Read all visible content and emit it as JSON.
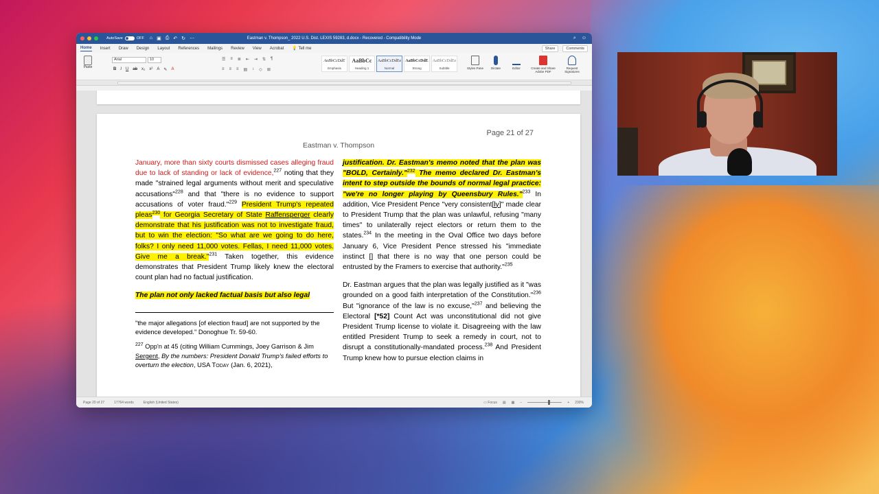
{
  "window": {
    "title": "Eastman v. Thompson_ 2022 U.S. Dist. LEXIS 59283, d.docx  -  Recovered  -  Compatibility Mode",
    "autosave_label": "AutoSave",
    "autosave_state": "OFF"
  },
  "ribbon_tabs": [
    "Home",
    "Insert",
    "Draw",
    "Design",
    "Layout",
    "References",
    "Mailings",
    "Review",
    "View",
    "Acrobat"
  ],
  "tell_me": "Tell me",
  "share_label": "Share",
  "comments_label": "Comments",
  "ribbon": {
    "paste_label": "Paste",
    "font_name": "Arial",
    "font_size": "10",
    "styles": [
      {
        "preview": "AaBbCcDdE",
        "name": "Emphasis"
      },
      {
        "preview": "AaBbCc",
        "name": "Heading 1"
      },
      {
        "preview": "AaBbCcDdEe",
        "name": "Normal"
      },
      {
        "preview": "AaBbCcDdE",
        "name": "Strong"
      },
      {
        "preview": "AaBbCcDdEe",
        "name": "Subtitle"
      }
    ],
    "styles_pane": "Styles\nPane",
    "dictate": "Dictate",
    "editor": "Editor",
    "create_pdf": "Create and Share\nAdobe PDF",
    "request_signatures": "Request\nSignatures"
  },
  "document": {
    "page_number": "Page 21 of 27",
    "running_head": "Eastman v. Thompson",
    "left_col": {
      "p1_red": "January, more than sixty courts dismissed cases alleging fraud due to lack of standing or lack of evidence,",
      "fn227": "227",
      "p1_a": " noting that they made \"strained legal arguments without merit and speculative accusations\"",
      "fn228": "228",
      "p1_b": " and that \"there is no evidence to support accusations of voter fraud.\"",
      "fn229": "229",
      "p1_hl1": "President Trump's repeated pleas",
      "fn230": "230",
      "p1_hl2": " for Georgia Secretary of State ",
      "raffensperger": "Raffensperger",
      "p1_hl3": " clearly demonstrate that his justification was not to investigate fraud, but to win the election: \"So what are we going to do here, folks? I only need 11,000 votes. Fellas, I need 11,000 votes. Give me a break.\"",
      "fn231": "231",
      "p1_c": " Taken together, this evidence demonstrates that President Trump likely knew the electoral count plan had no factual justification.",
      "p2_bi": "The plan not only lacked factual basis but also legal",
      "footnote_cont": "\"the major allegations [of election fraud] are not supported by the evidence developed.\" Donoghue Tr. 59-60.",
      "footnote227_num": "227",
      "footnote227_a": " Opp'n at 45 (citing William Cummings, Joey Garrison & Jim ",
      "sergent": "Sergent",
      "footnote227_b": ", ",
      "footnote227_italic": "By the numbers: President Donald Trump's failed efforts to overturn the election",
      "footnote227_c": ", USA ",
      "today": "Today",
      "footnote227_d": " (Jan. 6, 2021),"
    },
    "right_col": {
      "p1_bi1": "justification. Dr. Eastman's memo noted that the plan was \"BOLD, Certainly.\"",
      "fn232": "232",
      "p1_bi2": " The memo declared Dr. Eastman's intent to step outside the bounds of normal legal practice: \"we're no longer playing by Queensbury Rules.\"",
      "fn233": "233",
      "p1_a": " In addition, Vice President Pence \"very consistent",
      "ly": "[ly]",
      "p1_b": "\" made clear to President Trump that the plan was unlawful, refusing \"many times\" to unilaterally reject electors or return them to the states.",
      "fn234": "234",
      "p1_c": " In the meeting in the Oval Office two days before January 6, Vice President Pence stressed his \"immediate instinct [] that there is no way that one person could be entrusted by the Framers to exercise that authority.\"",
      "fn235": "235",
      "p2_a": "Dr. Eastman argues that the plan was legally justified as it \"was grounded on a good faith interpretation of the Constitution.\"",
      "fn236": "236",
      "p2_b": " But \"ignorance of the law is no excuse,\"",
      "fn237": "237",
      "p2_c": " and believing the Electoral ",
      "star52": "[*52]",
      "p2_d": "  Count Act was unconstitutional did not give President Trump license to violate it. Disagreeing with the law entitled President Trump to seek a remedy in court, not to disrupt a constitutionally-mandated process.",
      "fn238": "238",
      "p2_e": " And President Trump knew how to pursue election claims in"
    }
  },
  "status": {
    "page": "Page 20 of 27",
    "words": "17764 words",
    "language": "English (United States)",
    "focus": "Focus",
    "zoom": "230%"
  }
}
